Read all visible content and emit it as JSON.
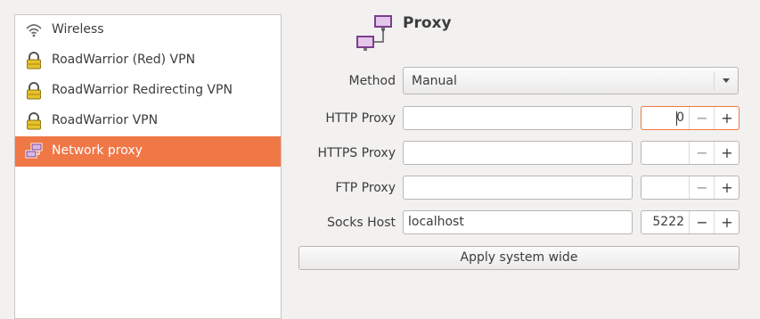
{
  "sidebar": {
    "items": [
      {
        "label": "Wireless",
        "icon": "wireless-icon"
      },
      {
        "label": "RoadWarrior (Red) VPN",
        "icon": "vpn-lock-icon"
      },
      {
        "label": "RoadWarrior Redirecting VPN",
        "icon": "vpn-lock-icon"
      },
      {
        "label": "RoadWarrior VPN",
        "icon": "vpn-lock-icon"
      },
      {
        "label": "Network proxy",
        "icon": "network-proxy-icon",
        "selected": true
      }
    ]
  },
  "header": {
    "title": "Proxy",
    "icon": "network-proxy-icon"
  },
  "form": {
    "method": {
      "label": "Method",
      "value": "Manual"
    },
    "http": {
      "label": "HTTP Proxy",
      "host": "",
      "port": "0"
    },
    "https": {
      "label": "HTTPS Proxy",
      "host": "",
      "port": ""
    },
    "ftp": {
      "label": "FTP Proxy",
      "host": "",
      "port": ""
    },
    "socks": {
      "label": "Socks Host",
      "host": "localhost",
      "port": "5222"
    },
    "spin_minus": "−",
    "spin_plus": "+"
  },
  "apply_button": "Apply system wide",
  "colors": {
    "accent": "#f07746",
    "background": "#f2f1f0"
  }
}
